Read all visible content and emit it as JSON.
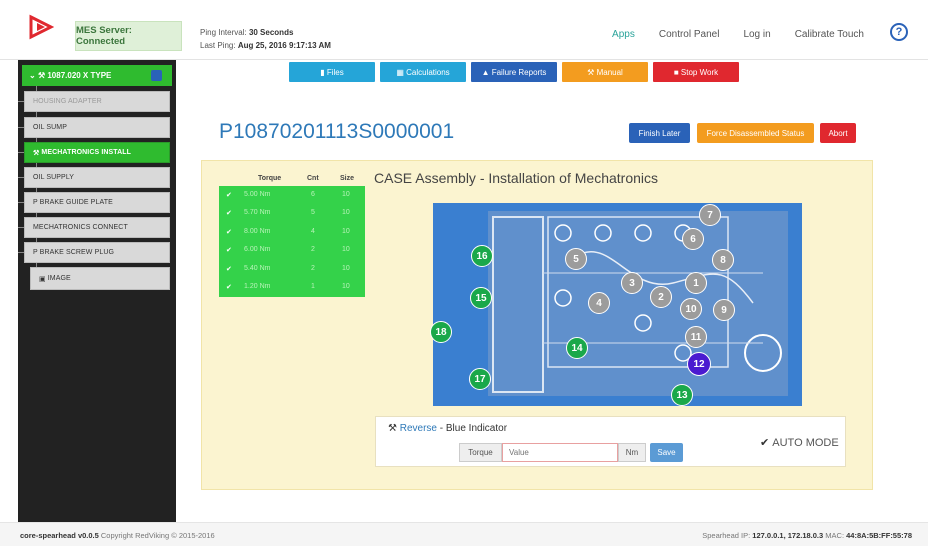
{
  "header": {
    "mes_status": "MES Server: Connected",
    "ping_interval_label": "Ping Interval:",
    "ping_interval_value": "30 Seconds",
    "last_ping_label": "Last Ping:",
    "last_ping_value": "Aug 25, 2016 9:17:13 AM",
    "nav": [
      "Apps",
      "Control Panel",
      "Log in",
      "Calibrate Touch"
    ],
    "help_symbol": "?"
  },
  "sidebar": {
    "top_label": "1087.020 X TYPE",
    "items": [
      {
        "label": "HOUSING ADAPTER",
        "state": "muted"
      },
      {
        "label": "OIL SUMP",
        "state": "normal"
      },
      {
        "label": "MECHATRONICS INSTALL",
        "state": "active"
      },
      {
        "label": "OIL SUPPLY",
        "state": "normal"
      },
      {
        "label": "P BRAKE GUIDE PLATE",
        "state": "normal"
      },
      {
        "label": "MECHATRONICS CONNECT",
        "state": "normal"
      },
      {
        "label": "P BRAKE SCREW PLUG",
        "state": "normal"
      }
    ],
    "image_label": "IMAGE"
  },
  "toolbar": {
    "files": "Files",
    "calculations": "Calculations",
    "failure_reports": "Failure Reports",
    "manual": "Manual",
    "stop_work": "Stop Work"
  },
  "main": {
    "serial": "P10870201113S0000001",
    "finish_later": "Finish Later",
    "force_disassembled": "Force Disassembled Status",
    "abort": "Abort",
    "assembly_title": "CASE Assembly - Installation of Mechatronics",
    "table_headers": [
      "Torque",
      "Cnt",
      "Size"
    ],
    "table_rows": [
      [
        "5.00 Nm",
        "6",
        "10"
      ],
      [
        "5.70 Nm",
        "5",
        "10"
      ],
      [
        "8.00 Nm",
        "4",
        "10"
      ],
      [
        "6.00 Nm",
        "2",
        "10"
      ],
      [
        "5.40 Nm",
        "2",
        "10"
      ],
      [
        "1.20 Nm",
        "1",
        "10"
      ]
    ],
    "gray_markers": [
      "1",
      "2",
      "3",
      "4",
      "5",
      "6",
      "7",
      "8",
      "9",
      "10",
      "11"
    ],
    "current_marker": "12",
    "green_markers": [
      "13",
      "14",
      "15",
      "16",
      "17",
      "18"
    ]
  },
  "input_box": {
    "tool_label": "Reverse",
    "indicator": " - Blue Indicator",
    "torque_label": "Torque",
    "value_placeholder": "Value",
    "unit": "Nm",
    "save": "Save",
    "mode": "AUTO MODE"
  },
  "footer": {
    "app": "core-spearhead v0.0.5",
    "copyright": "Copyright RedViking © 2015-2016",
    "ip_label": "Spearhead IP:",
    "ip_value": "127.0.0.1, 172.18.0.3",
    "mac_label": "MAC:",
    "mac_value": "44:8A:5B:FF:55:78"
  },
  "colors": {
    "accent_green": "#2fbb2f",
    "accent_blue": "#2e79b8",
    "files_btn": "#25a5d8",
    "manual_btn": "#f39c1f",
    "stop_btn": "#e0282f",
    "failure_btn": "#2a62b8"
  }
}
